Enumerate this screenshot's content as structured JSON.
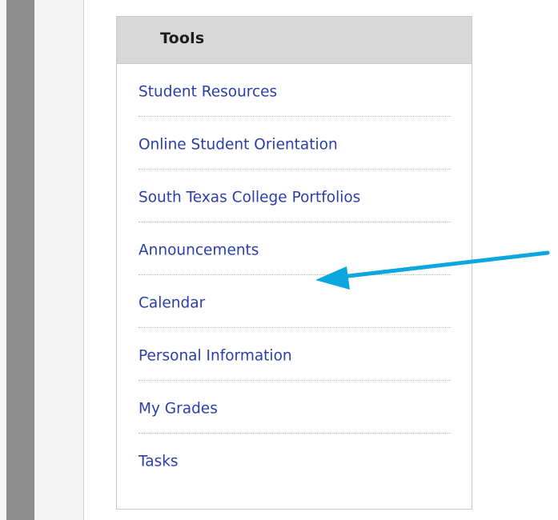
{
  "tools_module": {
    "title": "Tools",
    "items": [
      {
        "label": "Student Resources"
      },
      {
        "label": "Online Student Orientation"
      },
      {
        "label": "South Texas College Portfolios"
      },
      {
        "label": "Announcements"
      },
      {
        "label": "Calendar"
      },
      {
        "label": "Personal Information"
      },
      {
        "label": "My Grades"
      },
      {
        "label": "Tasks"
      }
    ]
  },
  "annotation": {
    "icon": "arrow-icon",
    "color": "#0aa6de",
    "target": "Calendar"
  },
  "colors": {
    "link": "#2a3eab",
    "header_bg": "#d8d8d8",
    "dark_bar": "#8e8e8e"
  }
}
